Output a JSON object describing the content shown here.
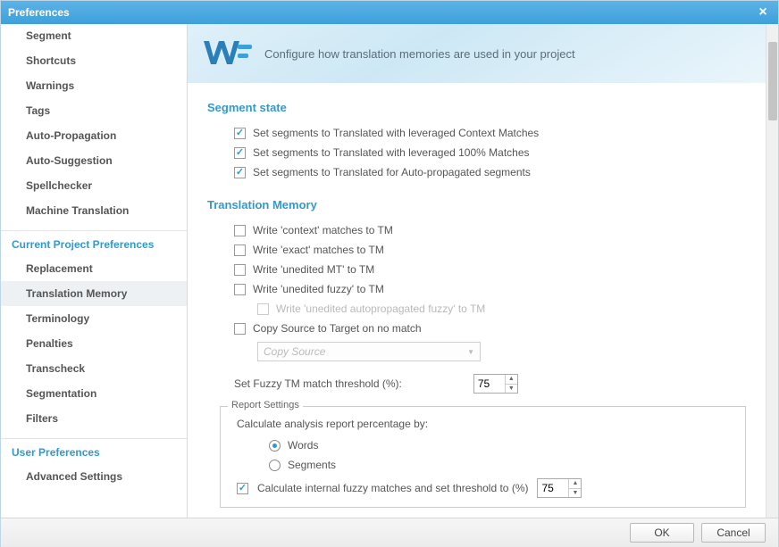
{
  "window": {
    "title": "Preferences"
  },
  "sidebar": {
    "groups": [
      {
        "heading": null,
        "items": [
          {
            "label": "Segment",
            "partial": true
          },
          {
            "label": "Shortcuts"
          },
          {
            "label": "Warnings"
          },
          {
            "label": "Tags"
          },
          {
            "label": "Auto-Propagation"
          },
          {
            "label": "Auto-Suggestion"
          },
          {
            "label": "Spellchecker"
          },
          {
            "label": "Machine Translation"
          }
        ]
      },
      {
        "heading": "Current Project Preferences",
        "items": [
          {
            "label": "Replacement"
          },
          {
            "label": "Translation Memory",
            "selected": true
          },
          {
            "label": "Terminology"
          },
          {
            "label": "Penalties"
          },
          {
            "label": "Transcheck"
          },
          {
            "label": "Segmentation"
          },
          {
            "label": "Filters"
          }
        ]
      },
      {
        "heading": "User Preferences",
        "items": [
          {
            "label": "Advanced Settings"
          }
        ]
      }
    ]
  },
  "banner": {
    "desc": "Configure how translation memories are used in your project"
  },
  "segment_state": {
    "title": "Segment state",
    "opt1": {
      "label": "Set segments to Translated with leveraged Context Matches",
      "checked": true
    },
    "opt2": {
      "label": "Set segments to Translated with leveraged 100% Matches",
      "checked": true
    },
    "opt3": {
      "label": "Set segments to Translated for Auto-propagated segments",
      "checked": true
    }
  },
  "tm": {
    "title": "Translation Memory",
    "write_context": {
      "label": "Write 'context' matches to TM",
      "checked": false
    },
    "write_exact": {
      "label": "Write 'exact' matches to TM",
      "checked": false
    },
    "write_mt": {
      "label": "Write 'unedited MT' to TM",
      "checked": false
    },
    "write_fuzzy": {
      "label": "Write 'unedited fuzzy' to TM",
      "checked": false
    },
    "write_autofuzzy": {
      "label": "Write 'unedited autopropagated fuzzy' to TM",
      "checked": false,
      "disabled": true
    },
    "copy_source": {
      "label": "Copy Source to Target on no match",
      "checked": false
    },
    "copy_select": {
      "placeholder": "Copy Source",
      "disabled": true
    },
    "threshold_label": "Set Fuzzy TM match threshold (%):",
    "threshold_value": "75"
  },
  "report": {
    "legend": "Report Settings",
    "calc_label": "Calculate analysis report percentage by:",
    "radio_words": {
      "label": "Words",
      "checked": true
    },
    "radio_segments": {
      "label": "Segments",
      "checked": false
    },
    "internal_fuzzy": {
      "label": "Calculate internal fuzzy matches and set threshold to (%)",
      "checked": true
    },
    "internal_value": "75"
  },
  "footer": {
    "ok": "OK",
    "cancel": "Cancel"
  }
}
